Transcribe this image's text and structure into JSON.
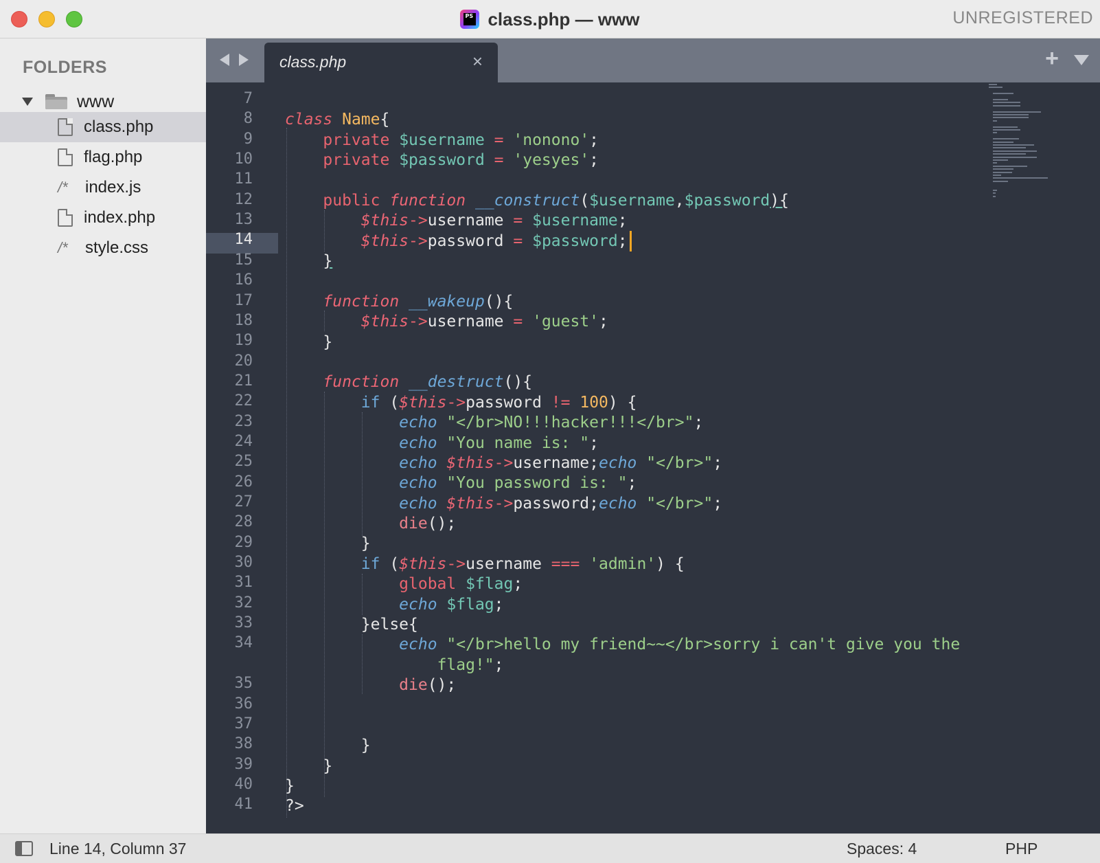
{
  "window": {
    "title": "class.php — www",
    "app_icon_text": "PS",
    "license": "UNREGISTERED"
  },
  "sidebar": {
    "header": "FOLDERS",
    "root": "www",
    "files": [
      {
        "name": "class.php",
        "icon": "file-icon",
        "active": true
      },
      {
        "name": "flag.php",
        "icon": "file-icon",
        "active": false
      },
      {
        "name": "index.js",
        "icon": "comment-file-icon",
        "active": false
      },
      {
        "name": "index.php",
        "icon": "file-icon",
        "active": false
      },
      {
        "name": "style.css",
        "icon": "comment-file-icon",
        "active": false
      }
    ],
    "comment_glyph": "/*"
  },
  "tabs": {
    "active_tab": "class.php",
    "close_glyph": "×",
    "new_tab_glyph": "+"
  },
  "editor": {
    "current_line": 14,
    "line_numbers": [
      "7",
      "8",
      "9",
      "10",
      "11",
      "12",
      "13",
      "14",
      "15",
      "16",
      "17",
      "18",
      "19",
      "20",
      "21",
      "22",
      "23",
      "24",
      "25",
      "26",
      "27",
      "28",
      "29",
      "30",
      "31",
      "32",
      "33",
      "34",
      "",
      "35",
      "36",
      "37",
      "38",
      "39",
      "40",
      "41"
    ],
    "code": {
      "l8_kw": "class",
      "l8_name": "Name",
      "l8_brace": "{",
      "private": "private",
      "l9_var": "$username",
      "eq": "=",
      "l9_str": "'nonono'",
      "semi": ";",
      "l10_var": "$password",
      "l10_str": "'yesyes'",
      "public": "public",
      "function": "function",
      "construct": "__construct",
      "paren_open": "(",
      "comma": ",",
      "paren_close_brace": "){",
      "var_username": "$username",
      "var_password": "$password",
      "this": "$this",
      "arrow": "->",
      "prop_username": "username",
      "prop_password": "password",
      "close_brace": "}",
      "wakeup": "__wakeup",
      "empty_parens_brace": "(){",
      "str_guest": "'guest'",
      "destruct": "__destruct",
      "if": "if",
      "open_paren_space": "(",
      "neq": "!=",
      "num100": "100",
      "close_paren_brace": ") {",
      "echo": "echo",
      "str_hacker": "\"</br>NO!!!hacker!!!</br>\"",
      "str_name": "\"You name is: \"",
      "str_br": "\"</br>\"",
      "str_pwd": "\"You password is: \"",
      "die": "die",
      "die_tail": "();",
      "eqeqeq": "===",
      "str_admin": "'admin'",
      "global": "global",
      "var_flag": "$flag",
      "else_open": "}else{",
      "str_friend_a": "\"</br>hello my friend~~</br>sorry i can't give you the",
      "str_friend_b": "flag!\"",
      "php_close": "?>"
    }
  },
  "status": {
    "position": "Line 14, Column 37",
    "indentation": "Spaces: 4",
    "syntax": "PHP"
  },
  "colors": {
    "editor_bg": "#2f343f",
    "keyword": "#e8646f",
    "function_italic": "#6ea8d8",
    "variable": "#73c7b4",
    "string": "#9dcf8a",
    "number_class": "#f5b961",
    "caret": "#f5a623"
  }
}
